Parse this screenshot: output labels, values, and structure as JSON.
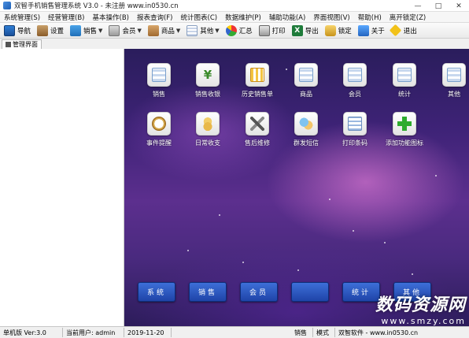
{
  "window": {
    "title": "双智手机销售管理系统 V3.0 - 未注册 www.in0530.cn",
    "controls": [
      "—",
      "□",
      "✕"
    ]
  },
  "menu": [
    "系统管理(S)",
    "经营管理(B)",
    "基本操作(B)",
    "报表查询(F)",
    "统计图表(C)",
    "数据维护(P)",
    "辅助功能(A)",
    "界面视图(V)",
    "帮助(H)",
    "离开锁定(Z)"
  ],
  "toolbar": [
    {
      "label": "导航",
      "icon": "navigation-icon",
      "dropdown": false
    },
    {
      "label": "设置",
      "icon": "settings-icon",
      "dropdown": false
    },
    {
      "label": "销售",
      "icon": "sales-icon",
      "dropdown": true
    },
    {
      "label": "会员",
      "icon": "member-icon",
      "dropdown": true
    },
    {
      "label": "商品",
      "icon": "goods-icon",
      "dropdown": true
    },
    {
      "label": "其他",
      "icon": "other-icon",
      "dropdown": true
    },
    {
      "label": "汇总",
      "icon": "summary-icon",
      "dropdown": false
    },
    {
      "label": "打印",
      "icon": "print-icon",
      "dropdown": false
    },
    {
      "label": "导出",
      "icon": "export-icon",
      "dropdown": false
    },
    {
      "label": "锁定",
      "icon": "lock-icon",
      "dropdown": false
    },
    {
      "label": "关于",
      "icon": "about-icon",
      "dropdown": false
    },
    {
      "label": "退出",
      "icon": "exit-icon",
      "dropdown": false
    }
  ],
  "tab": {
    "label": "管理界面"
  },
  "tiles": [
    {
      "label": "销售",
      "icon": "sales-grid-icon"
    },
    {
      "label": "销售收银",
      "icon": "cashier-yen-icon"
    },
    {
      "label": "历史销售单",
      "icon": "history-orders-icon"
    },
    {
      "label": "商品",
      "icon": "goods-grid-icon"
    },
    {
      "label": "会员",
      "icon": "member-grid-icon"
    },
    {
      "label": "统计",
      "icon": "statistics-grid-icon"
    },
    {
      "label": "其他",
      "icon": "other-grid-icon"
    },
    {
      "label": "事件提醒",
      "icon": "reminder-clock-icon"
    },
    {
      "label": "日常收支",
      "icon": "daily-income-coins-icon"
    },
    {
      "label": "售后维修",
      "icon": "repair-tools-icon"
    },
    {
      "label": "群发短信",
      "icon": "sms-chat-icon"
    },
    {
      "label": "打印条码",
      "icon": "barcode-document-icon"
    },
    {
      "label": "添加功能图标",
      "icon": "add-plus-icon"
    }
  ],
  "bottom_buttons": [
    "系统",
    "销售",
    "会员",
    "",
    "统计",
    "其他"
  ],
  "watermark": {
    "title": "数码资源网",
    "url": "www.smzy.com"
  },
  "status": [
    "单机版 Ver:3.0",
    "当前用户: admin",
    "2019-11-20",
    "销售",
    "模式",
    "双智软件 - www.in0530.cn"
  ]
}
